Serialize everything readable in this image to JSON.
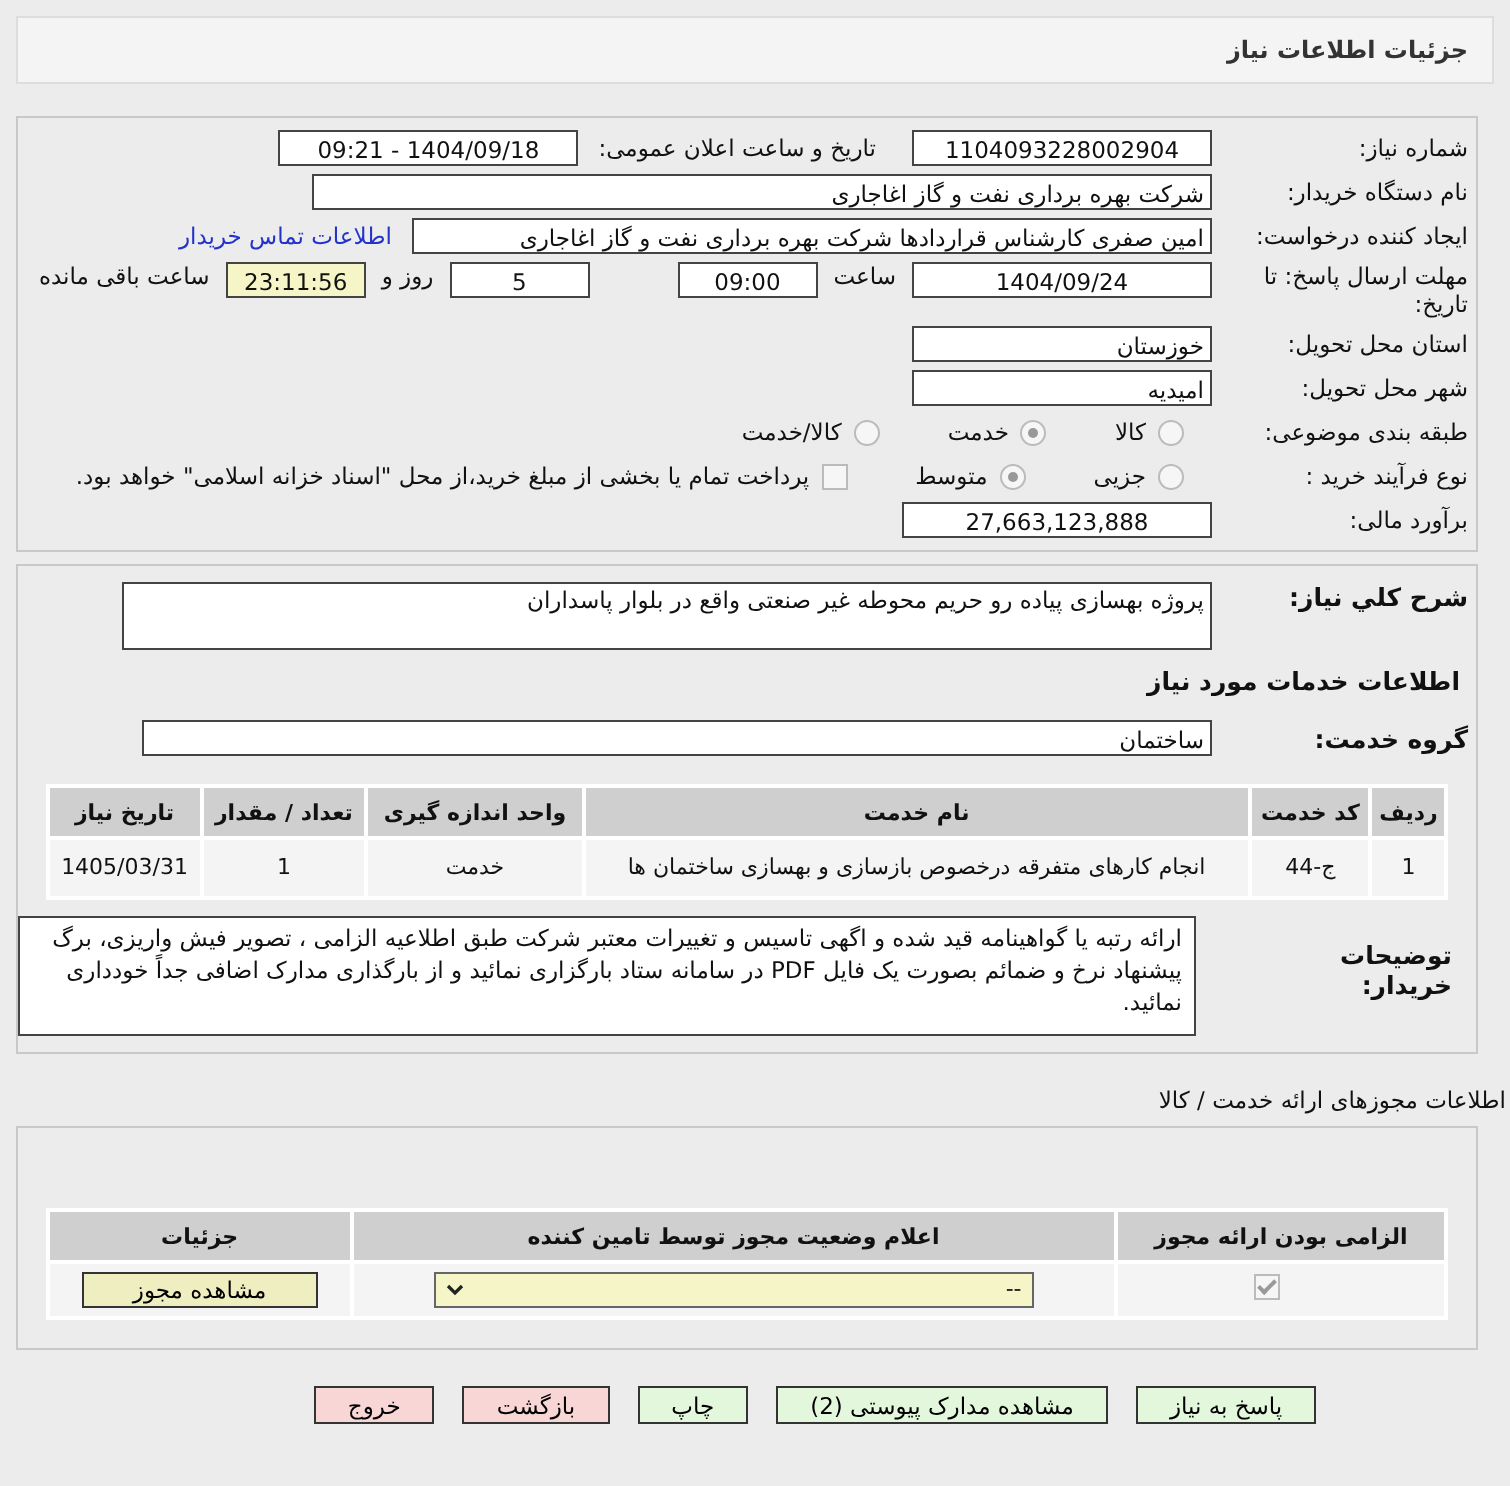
{
  "header": {
    "title": "جزئیات اطلاعات نیاز"
  },
  "need_number": {
    "label": "شماره نیاز:",
    "value": "1104093228002904"
  },
  "announce": {
    "label": "تاریخ و ساعت اعلان عمومی:",
    "value": "1404/09/18 - 09:21"
  },
  "buyer": {
    "label": "نام دستگاه خریدار:",
    "value": "شرکت بهره برداری نفت و گاز اغاجاری"
  },
  "creator": {
    "label": "ایجاد کننده درخواست:",
    "value": "امین صفری کارشناس قراردادها شرکت بهره برداری نفت و گاز اغاجاری",
    "contact_link": "اطلاعات تماس خریدار"
  },
  "deadline": {
    "label": "مهلت ارسال پاسخ: تا تاریخ:",
    "date": "1404/09/24",
    "time_label": "ساعت",
    "time": "09:00",
    "days": "5",
    "days_label": "روز و",
    "remaining": "23:11:56",
    "remaining_label": "ساعت باقی مانده"
  },
  "province": {
    "label": "استان محل تحویل:",
    "value": "خوزستان"
  },
  "city": {
    "label": "شهر محل تحویل:",
    "value": "امیدیه"
  },
  "category": {
    "label": "طبقه بندی موضوعی:",
    "options": [
      {
        "label": "کالا",
        "selected": false
      },
      {
        "label": "خدمت",
        "selected": true
      },
      {
        "label": "کالا/خدمت",
        "selected": false
      }
    ]
  },
  "process": {
    "label": "نوع فرآیند خرید :",
    "options": [
      {
        "label": "جزیی",
        "selected": false
      },
      {
        "label": "متوسط",
        "selected": true
      }
    ],
    "payment": {
      "label": "پرداخت تمام یا بخشی از مبلغ خرید،از محل \"اسناد خزانه اسلامی\" خواهد بود.",
      "checked": false
    }
  },
  "estimate": {
    "label": "برآورد مالی:",
    "value": "27,663,123,888"
  },
  "description": {
    "label": "شرح کلي نياز:",
    "value": "پروژه بهسازی پیاده رو حریم محوطه غیر صنعتی واقع در بلوار پاسداران"
  },
  "services_heading": "اطلاعات خدمات مورد نیاز",
  "service_group": {
    "label": "گروه خدمت:",
    "value": "ساختمان"
  },
  "services_table": {
    "columns": [
      "ردیف",
      "کد خدمت",
      "نام خدمت",
      "واحد اندازه گیری",
      "تعداد / مقدار",
      "تاریخ نیاز"
    ],
    "rows": [
      [
        "1",
        "ج-44",
        "انجام کارهای متفرقه درخصوص بازسازی و بهسازی ساختمان ها",
        "خدمت",
        "1",
        "1405/03/31"
      ]
    ]
  },
  "buyer_notes": {
    "label": "توضیحات خریدار:",
    "value": "ارائه رتبه یا گواهینامه قید شده و اگهی تاسیس و تغییرات معتبر شرکت طبق اطلاعیه الزامی ، تصویر فیش واریزی، برگ پیشنهاد نرخ و ضمائم بصورت یک فایل PDF در سامانه ستاد بارگزاری نمائید و از بارگذاری مدارک اضافی جداً خودداری نمائید."
  },
  "licenses_heading": "اطلاعات مجوزهای ارائه خدمت / کالا",
  "licenses_table": {
    "columns": [
      "الزامی بودن ارائه مجوز",
      "اعلام وضعیت مجوز توسط تامین کننده",
      "جزئیات"
    ],
    "rows": [
      {
        "required": true,
        "status": "--",
        "details_button": "مشاهده مجوز"
      }
    ]
  },
  "buttons": [
    {
      "label": "پاسخ به نیاز",
      "kind": "normal"
    },
    {
      "label": "مشاهده مدارک پیوستی (2)",
      "kind": "normal"
    },
    {
      "label": "چاپ",
      "kind": "normal"
    },
    {
      "label": "بازگشت",
      "kind": "danger"
    },
    {
      "label": "خروج",
      "kind": "danger"
    }
  ]
}
